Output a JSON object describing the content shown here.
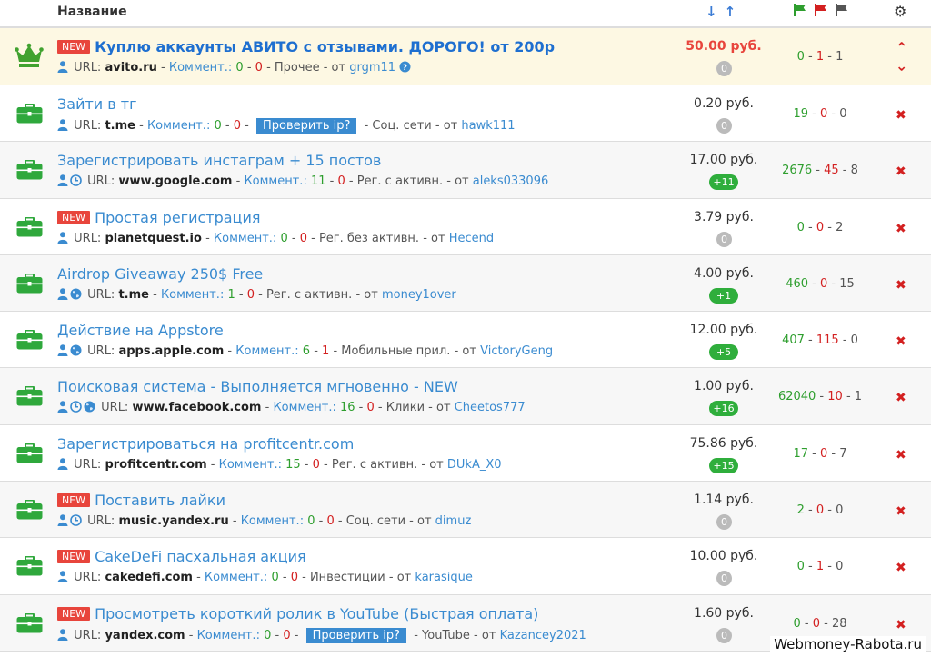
{
  "header": {
    "col_name": "Название",
    "sort_arrows": "↓↑"
  },
  "labels": {
    "url": "URL:",
    "comments": "Коммент.:",
    "from": "от",
    "check_ip": "Проверить ip?",
    "new": "NEW",
    "currency": "руб."
  },
  "colors": {
    "accent": "#3a8bd0",
    "green": "#2e9e2e",
    "red": "#d32020",
    "new_badge": "#e8453c",
    "vip_bg": "#fdf8e3"
  },
  "tasks": [
    {
      "vip": true,
      "new": true,
      "title": "Куплю аккаунты АВИТО с отзывами. ДОРОГО! от 200р",
      "icons": [
        "user"
      ],
      "url": "avito.ru",
      "c_good": "0",
      "c_bad": "0",
      "category": "Прочее",
      "author": "grgm11",
      "help_icon": true,
      "price": "50.00 руб.",
      "pill": "0",
      "pill_green": false,
      "s1": "0",
      "s2": "1",
      "s3": "1",
      "check_ip": false
    },
    {
      "vip": false,
      "new": false,
      "title": "Зайти в тг",
      "icons": [
        "user"
      ],
      "url": "t.me",
      "c_good": "0",
      "c_bad": "0",
      "category": "Соц. сети",
      "author": "hawk111",
      "price": "0.20 руб.",
      "pill": "0",
      "pill_green": false,
      "s1": "19",
      "s2": "0",
      "s3": "0",
      "check_ip": true
    },
    {
      "vip": false,
      "new": false,
      "title": "Зарегистрировать инстаграм + 15 постов",
      "icons": [
        "user",
        "clock"
      ],
      "url": "www.google.com",
      "c_good": "11",
      "c_bad": "0",
      "category": "Рег. с активн.",
      "author": "aleks033096",
      "price": "17.00 руб.",
      "pill": "+11",
      "pill_green": true,
      "s1": "2676",
      "s2": "45",
      "s3": "8",
      "check_ip": false
    },
    {
      "vip": false,
      "new": true,
      "title": "Простая регистрация",
      "icons": [
        "user"
      ],
      "url": "planetquest.io",
      "c_good": "0",
      "c_bad": "0",
      "category": "Рег. без активн.",
      "author": "Hecend",
      "price": "3.79 руб.",
      "pill": "0",
      "pill_green": false,
      "s1": "0",
      "s2": "0",
      "s3": "2",
      "check_ip": false
    },
    {
      "vip": false,
      "new": false,
      "title": "Airdrop Giveaway 250$ Free",
      "icons": [
        "user",
        "globe"
      ],
      "url": "t.me",
      "c_good": "1",
      "c_bad": "0",
      "category": "Рег. с активн.",
      "author": "money1over",
      "price": "4.00 руб.",
      "pill": "+1",
      "pill_green": true,
      "s1": "460",
      "s2": "0",
      "s3": "15",
      "check_ip": false
    },
    {
      "vip": false,
      "new": false,
      "title": "Действие на Appstore",
      "icons": [
        "user",
        "globe"
      ],
      "url": "apps.apple.com",
      "c_good": "6",
      "c_bad": "1",
      "category": "Мобильные прил.",
      "author": "VictoryGeng",
      "price": "12.00 руб.",
      "pill": "+5",
      "pill_green": true,
      "s1": "407",
      "s2": "115",
      "s3": "0",
      "check_ip": false
    },
    {
      "vip": false,
      "new": false,
      "title": "Поисковая система - Выполняется мгновенно - NEW",
      "icons": [
        "user",
        "clock",
        "globe"
      ],
      "url": "www.facebook.com",
      "c_good": "16",
      "c_bad": "0",
      "category": "Клики",
      "author": "Cheetos777",
      "price": "1.00 руб.",
      "pill": "+16",
      "pill_green": true,
      "s1": "62040",
      "s2": "10",
      "s3": "1",
      "check_ip": false
    },
    {
      "vip": false,
      "new": false,
      "title": "Зарегистрироваться на profitcentr.com",
      "icons": [
        "user"
      ],
      "url": "profitcentr.com",
      "c_good": "15",
      "c_bad": "0",
      "category": "Рег. с активн.",
      "author": "DUkA_X0",
      "price": "75.86 руб.",
      "pill": "+15",
      "pill_green": true,
      "s1": "17",
      "s2": "0",
      "s3": "7",
      "check_ip": false
    },
    {
      "vip": false,
      "new": true,
      "title": "Поставить лайки",
      "icons": [
        "user",
        "clock"
      ],
      "url": "music.yandex.ru",
      "c_good": "0",
      "c_bad": "0",
      "category": "Соц. сети",
      "author": "dimuz",
      "price": "1.14 руб.",
      "pill": "0",
      "pill_green": false,
      "s1": "2",
      "s2": "0",
      "s3": "0",
      "check_ip": false
    },
    {
      "vip": false,
      "new": true,
      "title": "CakeDeFi пасхальная акция",
      "icons": [
        "user"
      ],
      "url": "cakedefi.com",
      "c_good": "0",
      "c_bad": "0",
      "category": "Инвестиции",
      "author": "karasique",
      "price": "10.00 руб.",
      "pill": "0",
      "pill_green": false,
      "s1": "0",
      "s2": "1",
      "s3": "0",
      "check_ip": false
    },
    {
      "vip": false,
      "new": true,
      "title": "Просмотреть короткий ролик в YouTube (Быстрая оплата)",
      "icons": [
        "user"
      ],
      "url": "yandex.com",
      "c_good": "0",
      "c_bad": "0",
      "category": "YouTube",
      "author": "Kazancey2021",
      "price": "1.60 руб.",
      "pill": "0",
      "pill_green": false,
      "s1": "0",
      "s2": "0",
      "s3": "28",
      "check_ip": true
    }
  ],
  "watermark": "Webmoney-Rabota.ru"
}
